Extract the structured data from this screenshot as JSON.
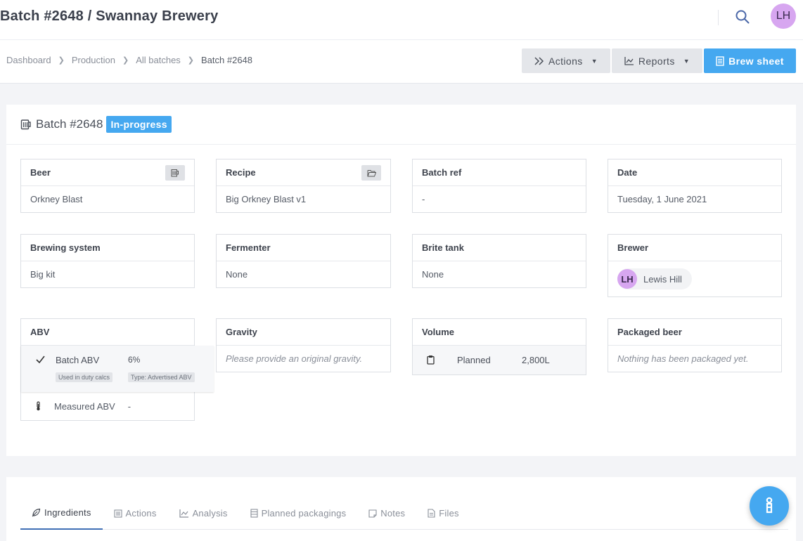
{
  "header": {
    "title": "Batch #2648 / Swannay Brewery",
    "avatar_initials": "LH"
  },
  "breadcrumb": [
    "Dashboard",
    "Production",
    "All batches",
    "Batch #2648"
  ],
  "toolbar": {
    "actions_label": "Actions",
    "reports_label": "Reports",
    "brew_sheet_label": "Brew sheet"
  },
  "batch": {
    "title": "Batch #2648",
    "status": "In-progress"
  },
  "fields": {
    "beer": {
      "label": "Beer",
      "value": "Orkney Blast"
    },
    "recipe": {
      "label": "Recipe",
      "value": "Big Orkney Blast v1"
    },
    "batch_ref": {
      "label": "Batch ref",
      "value": "-"
    },
    "date": {
      "label": "Date",
      "value": "Tuesday, 1 June 2021"
    },
    "brewing_system": {
      "label": "Brewing system",
      "value": "Big kit"
    },
    "fermenter": {
      "label": "Fermenter",
      "value": "None"
    },
    "brite_tank": {
      "label": "Brite tank",
      "value": "None"
    },
    "brewer": {
      "label": "Brewer",
      "initials": "LH",
      "name": "Lewis Hill"
    },
    "abv": {
      "label": "ABV",
      "batch_label": "Batch ABV",
      "batch_value": "6%",
      "tag_duty": "Used in duty calcs",
      "tag_type": "Type: Advertised ABV",
      "measured_label": "Measured ABV",
      "measured_value": "-"
    },
    "gravity": {
      "label": "Gravity",
      "value": "Please provide an original gravity."
    },
    "volume": {
      "label": "Volume",
      "planned_label": "Planned",
      "planned_value": "2,800L"
    },
    "packaged": {
      "label": "Packaged beer",
      "value": "Nothing has been packaged yet."
    }
  },
  "tabs": [
    {
      "label": "Ingredients",
      "icon": "leaf-icon"
    },
    {
      "label": "Actions",
      "icon": "list-icon"
    },
    {
      "label": "Analysis",
      "icon": "chart-icon"
    },
    {
      "label": "Planned packagings",
      "icon": "stack-icon"
    },
    {
      "label": "Notes",
      "icon": "note-icon"
    },
    {
      "label": "Files",
      "icon": "file-icon"
    }
  ],
  "colors": {
    "accent": "#45a8f0",
    "avatar": "#d7a6f0",
    "active_tab_underline": "#3f6fb5"
  }
}
